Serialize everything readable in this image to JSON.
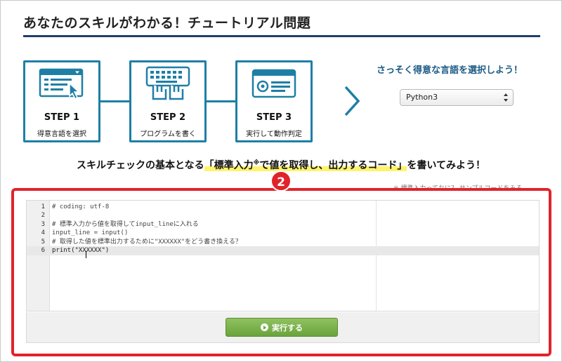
{
  "page": {
    "title": "あなたのスキルがわかる！チュートリアル問題"
  },
  "steps": [
    {
      "label": "STEP 1",
      "desc": "得意言語を選択",
      "icon": "select-list-icon"
    },
    {
      "label": "STEP 2",
      "desc": "プログラムを書く",
      "icon": "keyboard-typing-icon"
    },
    {
      "label": "STEP 3",
      "desc": "実行して動作判定",
      "icon": "browser-window-icon"
    }
  ],
  "language": {
    "prompt": "さっそく得意な言語を選択しよう！",
    "selected": "Python3"
  },
  "headline": {
    "before": "スキルチェックの基本となる",
    "open_bracket": "「",
    "highlight_1": "標準入力",
    "mark": "※",
    "highlight_2": "で値を取得し、出力するコード",
    "close_bracket": "」",
    "after": "を書いてみよう！"
  },
  "note": "※ 標準入力ってなに？ サンプルコードをみる",
  "badge": "2",
  "editor": {
    "lines": [
      {
        "num": "1",
        "text": "# coding: utf-8"
      },
      {
        "num": "2",
        "text": ""
      },
      {
        "num": "3",
        "text": "# 標準入力から値を取得してinput_lineに入れる"
      },
      {
        "num": "4",
        "text": "input_line = input()"
      },
      {
        "num": "5",
        "text": "# 取得した値を標準出力するために\"XXXXXX\"をどう書き換える？"
      },
      {
        "num": "6",
        "text": "print(\"XXXXXX\")"
      }
    ],
    "active_line": "6"
  },
  "run_button": {
    "label": "実行する"
  },
  "colors": {
    "accent": "#1e7fa5",
    "title_rule": "#1d3f6e",
    "highlight_box": "#e0242a",
    "run_green": "#6aa33c",
    "marker_yellow": "#fff36b"
  }
}
